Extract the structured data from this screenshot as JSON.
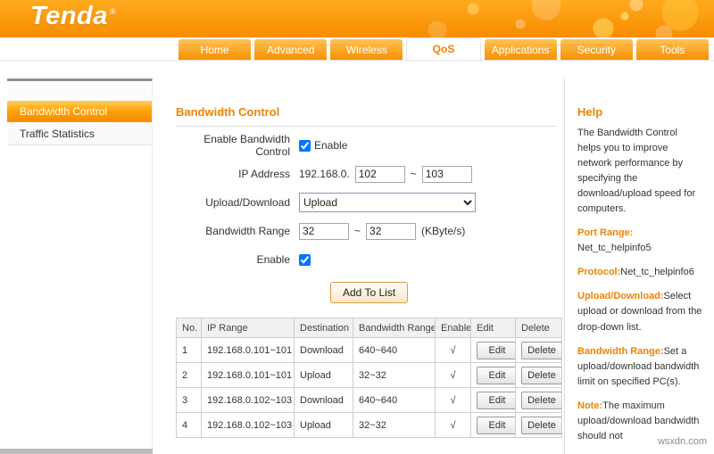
{
  "brand": {
    "logo": "Tenda",
    "logo_reg": "®"
  },
  "nav": {
    "tabs": [
      {
        "label": "Home"
      },
      {
        "label": "Advanced"
      },
      {
        "label": "Wireless"
      },
      {
        "label": "QoS"
      },
      {
        "label": "Applications"
      },
      {
        "label": "Security"
      },
      {
        "label": "Tools"
      }
    ]
  },
  "sidebar": {
    "items": [
      {
        "label": "Bandwidth Control"
      },
      {
        "label": "Traffic Statistics"
      }
    ]
  },
  "main": {
    "title": "Bandwidth Control",
    "form": {
      "enable_control_label": "Enable Bandwidth Control",
      "enable_checkbox_label": "Enable",
      "enable_control_checked": "checked",
      "ip_address_label": "IP Address",
      "ip_prefix": "192.168.0.",
      "ip_from": "102",
      "ip_to": "103",
      "separator": "~",
      "upload_download_label": "Upload/Download",
      "upload_download_value": "Upload",
      "bandwidth_range_label": "Bandwidth Range",
      "bandwidth_from": "32",
      "bandwidth_to": "32",
      "bandwidth_unit": "(KByte/s)",
      "rule_enable_label": "Enable",
      "rule_enable_checked": "checked",
      "add_button": "Add To List"
    },
    "table": {
      "headers": [
        "No.",
        "IP Range",
        "Destination",
        "Bandwidth Range",
        "Enable",
        "Edit",
        "Delete"
      ],
      "edit_label": "Edit",
      "delete_label": "Delete",
      "rows": [
        {
          "no": "1",
          "ip_range": "192.168.0.101~101",
          "destination": "Download",
          "bandwidth": "640~640",
          "enable": "√"
        },
        {
          "no": "2",
          "ip_range": "192.168.0.101~101",
          "destination": "Upload",
          "bandwidth": "32~32",
          "enable": "√"
        },
        {
          "no": "3",
          "ip_range": "192.168.0.102~103",
          "destination": "Download",
          "bandwidth": "640~640",
          "enable": "√"
        },
        {
          "no": "4",
          "ip_range": "192.168.0.102~103",
          "destination": "Upload",
          "bandwidth": "32~32",
          "enable": "√"
        }
      ]
    }
  },
  "help": {
    "title": "Help",
    "intro": "The Bandwidth Control helps you to improve network performance by specifying the download/upload speed for computers.",
    "sections": [
      {
        "label": "Port Range:",
        "text": "Net_tc_helpinfo5"
      },
      {
        "label": "Protocol:",
        "text": "Net_tc_helpinfo6"
      },
      {
        "label": "Upload/Download:",
        "text": "Select upload or download from the drop-down list."
      },
      {
        "label": "Bandwidth Range:",
        "text": "Set a upload/download bandwidth limit on specified PC(s)."
      },
      {
        "label": "Note:",
        "text": "The maximum upload/download bandwidth should not"
      }
    ]
  },
  "watermark": "wsxdn.com",
  "colors": {
    "accent": "#f08300",
    "header": "#f78c00"
  }
}
